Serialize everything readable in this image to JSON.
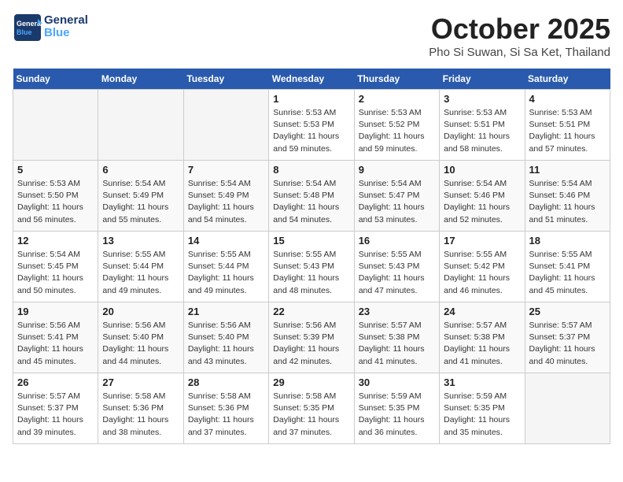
{
  "header": {
    "logo_text_general": "General",
    "logo_text_blue": "Blue",
    "month": "October 2025",
    "location": "Pho Si Suwan, Si Sa Ket, Thailand"
  },
  "days_of_week": [
    "Sunday",
    "Monday",
    "Tuesday",
    "Wednesday",
    "Thursday",
    "Friday",
    "Saturday"
  ],
  "weeks": [
    [
      {
        "day": "",
        "info": ""
      },
      {
        "day": "",
        "info": ""
      },
      {
        "day": "",
        "info": ""
      },
      {
        "day": "1",
        "info": "Sunrise: 5:53 AM\nSunset: 5:53 PM\nDaylight: 11 hours\nand 59 minutes."
      },
      {
        "day": "2",
        "info": "Sunrise: 5:53 AM\nSunset: 5:52 PM\nDaylight: 11 hours\nand 59 minutes."
      },
      {
        "day": "3",
        "info": "Sunrise: 5:53 AM\nSunset: 5:51 PM\nDaylight: 11 hours\nand 58 minutes."
      },
      {
        "day": "4",
        "info": "Sunrise: 5:53 AM\nSunset: 5:51 PM\nDaylight: 11 hours\nand 57 minutes."
      }
    ],
    [
      {
        "day": "5",
        "info": "Sunrise: 5:53 AM\nSunset: 5:50 PM\nDaylight: 11 hours\nand 56 minutes."
      },
      {
        "day": "6",
        "info": "Sunrise: 5:54 AM\nSunset: 5:49 PM\nDaylight: 11 hours\nand 55 minutes."
      },
      {
        "day": "7",
        "info": "Sunrise: 5:54 AM\nSunset: 5:49 PM\nDaylight: 11 hours\nand 54 minutes."
      },
      {
        "day": "8",
        "info": "Sunrise: 5:54 AM\nSunset: 5:48 PM\nDaylight: 11 hours\nand 54 minutes."
      },
      {
        "day": "9",
        "info": "Sunrise: 5:54 AM\nSunset: 5:47 PM\nDaylight: 11 hours\nand 53 minutes."
      },
      {
        "day": "10",
        "info": "Sunrise: 5:54 AM\nSunset: 5:46 PM\nDaylight: 11 hours\nand 52 minutes."
      },
      {
        "day": "11",
        "info": "Sunrise: 5:54 AM\nSunset: 5:46 PM\nDaylight: 11 hours\nand 51 minutes."
      }
    ],
    [
      {
        "day": "12",
        "info": "Sunrise: 5:54 AM\nSunset: 5:45 PM\nDaylight: 11 hours\nand 50 minutes."
      },
      {
        "day": "13",
        "info": "Sunrise: 5:55 AM\nSunset: 5:44 PM\nDaylight: 11 hours\nand 49 minutes."
      },
      {
        "day": "14",
        "info": "Sunrise: 5:55 AM\nSunset: 5:44 PM\nDaylight: 11 hours\nand 49 minutes."
      },
      {
        "day": "15",
        "info": "Sunrise: 5:55 AM\nSunset: 5:43 PM\nDaylight: 11 hours\nand 48 minutes."
      },
      {
        "day": "16",
        "info": "Sunrise: 5:55 AM\nSunset: 5:43 PM\nDaylight: 11 hours\nand 47 minutes."
      },
      {
        "day": "17",
        "info": "Sunrise: 5:55 AM\nSunset: 5:42 PM\nDaylight: 11 hours\nand 46 minutes."
      },
      {
        "day": "18",
        "info": "Sunrise: 5:55 AM\nSunset: 5:41 PM\nDaylight: 11 hours\nand 45 minutes."
      }
    ],
    [
      {
        "day": "19",
        "info": "Sunrise: 5:56 AM\nSunset: 5:41 PM\nDaylight: 11 hours\nand 45 minutes."
      },
      {
        "day": "20",
        "info": "Sunrise: 5:56 AM\nSunset: 5:40 PM\nDaylight: 11 hours\nand 44 minutes."
      },
      {
        "day": "21",
        "info": "Sunrise: 5:56 AM\nSunset: 5:40 PM\nDaylight: 11 hours\nand 43 minutes."
      },
      {
        "day": "22",
        "info": "Sunrise: 5:56 AM\nSunset: 5:39 PM\nDaylight: 11 hours\nand 42 minutes."
      },
      {
        "day": "23",
        "info": "Sunrise: 5:57 AM\nSunset: 5:38 PM\nDaylight: 11 hours\nand 41 minutes."
      },
      {
        "day": "24",
        "info": "Sunrise: 5:57 AM\nSunset: 5:38 PM\nDaylight: 11 hours\nand 41 minutes."
      },
      {
        "day": "25",
        "info": "Sunrise: 5:57 AM\nSunset: 5:37 PM\nDaylight: 11 hours\nand 40 minutes."
      }
    ],
    [
      {
        "day": "26",
        "info": "Sunrise: 5:57 AM\nSunset: 5:37 PM\nDaylight: 11 hours\nand 39 minutes."
      },
      {
        "day": "27",
        "info": "Sunrise: 5:58 AM\nSunset: 5:36 PM\nDaylight: 11 hours\nand 38 minutes."
      },
      {
        "day": "28",
        "info": "Sunrise: 5:58 AM\nSunset: 5:36 PM\nDaylight: 11 hours\nand 37 minutes."
      },
      {
        "day": "29",
        "info": "Sunrise: 5:58 AM\nSunset: 5:35 PM\nDaylight: 11 hours\nand 37 minutes."
      },
      {
        "day": "30",
        "info": "Sunrise: 5:59 AM\nSunset: 5:35 PM\nDaylight: 11 hours\nand 36 minutes."
      },
      {
        "day": "31",
        "info": "Sunrise: 5:59 AM\nSunset: 5:35 PM\nDaylight: 11 hours\nand 35 minutes."
      },
      {
        "day": "",
        "info": ""
      }
    ]
  ]
}
